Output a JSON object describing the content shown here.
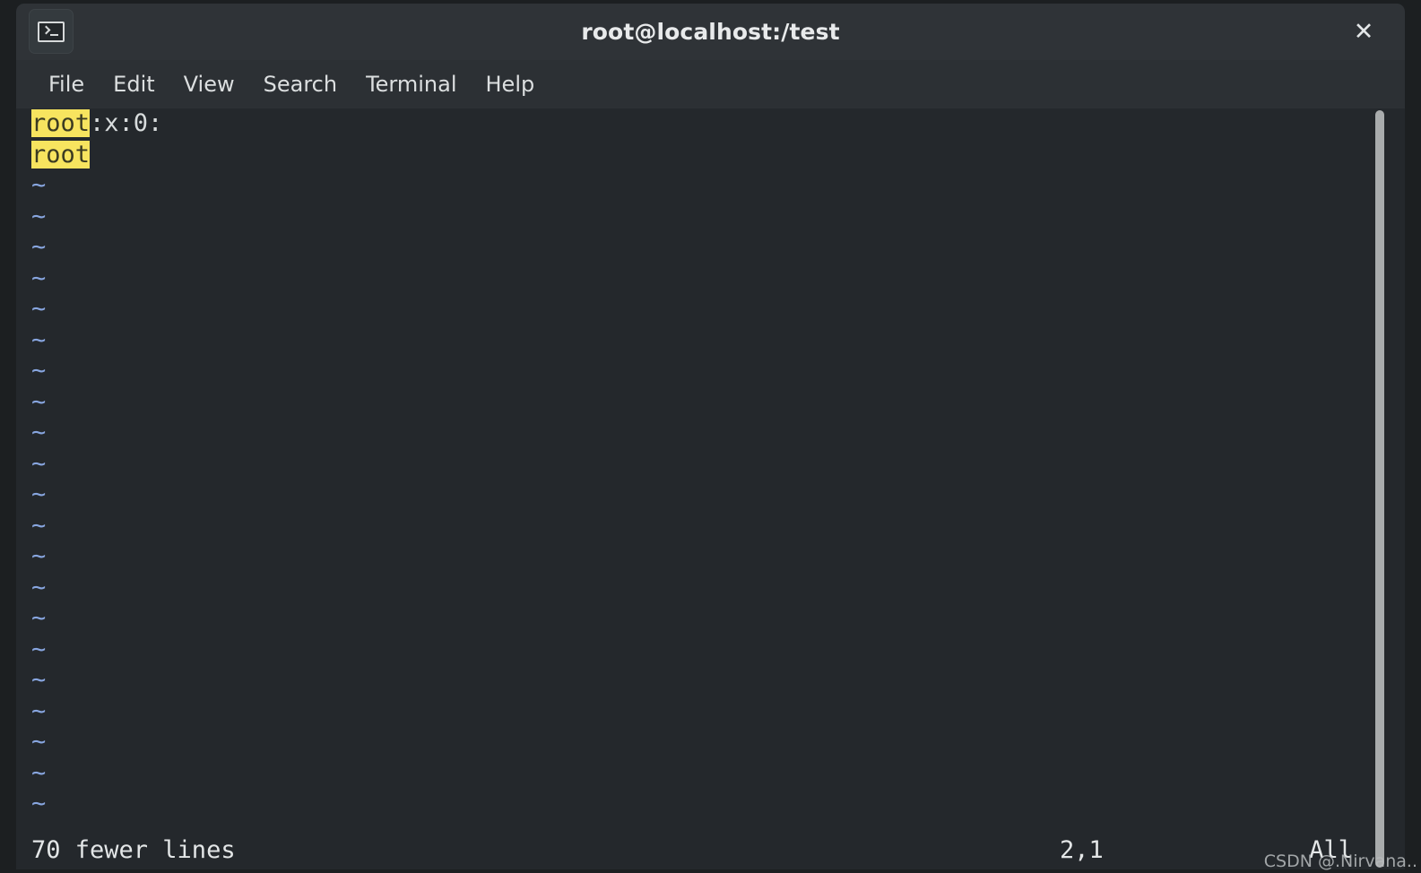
{
  "window": {
    "title": "root@localhost:/test",
    "icon": "terminal-icon",
    "close_label": "✕"
  },
  "menubar": {
    "items": [
      {
        "label": "File"
      },
      {
        "label": "Edit"
      },
      {
        "label": "View"
      },
      {
        "label": "Search"
      },
      {
        "label": "Terminal"
      },
      {
        "label": "Help"
      }
    ]
  },
  "editor": {
    "content_lines": [
      {
        "segments": [
          {
            "text": "root",
            "highlight": true
          },
          {
            "text": ":x:0:",
            "highlight": false
          }
        ]
      },
      {
        "segments": [
          {
            "text": "root",
            "highlight": true
          }
        ]
      }
    ],
    "empty_marker": "~",
    "empty_line_count": 21
  },
  "status": {
    "message": "70 fewer lines",
    "position": "2,1",
    "scroll": "All"
  },
  "scrollbar": {
    "orientation": "vertical",
    "thumb_position": "full"
  },
  "watermark": {
    "text": "CSDN @.Nirvana.."
  },
  "colors": {
    "window_frame": "#1c1f21",
    "titlebar_bg": "#2f3337",
    "menubar_bg": "#2c3034",
    "terminal_bg": "#24282c",
    "text_fg": "#d8dcdd",
    "search_highlight_bg": "#f7e45f",
    "search_highlight_fg": "#3b3b22",
    "tilde_fg": "#88a6e0",
    "scrollbar_thumb": "#a9acad"
  }
}
